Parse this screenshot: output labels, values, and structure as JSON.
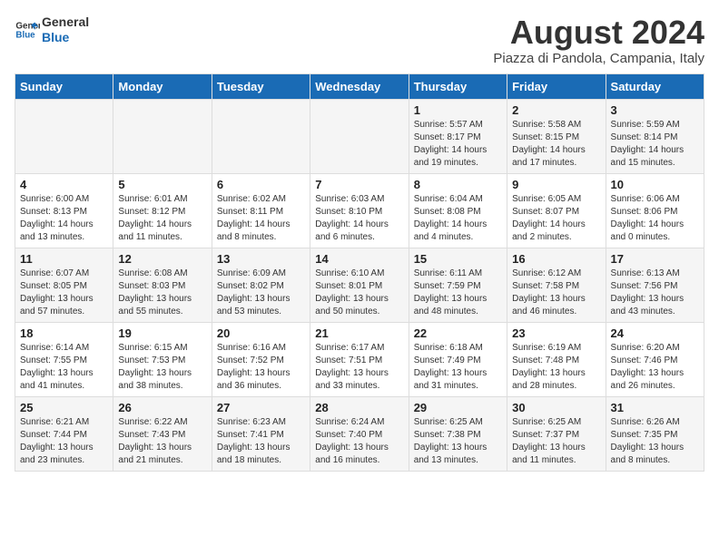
{
  "header": {
    "logo_line1": "General",
    "logo_line2": "Blue",
    "month_year": "August 2024",
    "location": "Piazza di Pandola, Campania, Italy"
  },
  "weekdays": [
    "Sunday",
    "Monday",
    "Tuesday",
    "Wednesday",
    "Thursday",
    "Friday",
    "Saturday"
  ],
  "weeks": [
    [
      {
        "day": "",
        "info": ""
      },
      {
        "day": "",
        "info": ""
      },
      {
        "day": "",
        "info": ""
      },
      {
        "day": "",
        "info": ""
      },
      {
        "day": "1",
        "info": "Sunrise: 5:57 AM\nSunset: 8:17 PM\nDaylight: 14 hours\nand 19 minutes."
      },
      {
        "day": "2",
        "info": "Sunrise: 5:58 AM\nSunset: 8:15 PM\nDaylight: 14 hours\nand 17 minutes."
      },
      {
        "day": "3",
        "info": "Sunrise: 5:59 AM\nSunset: 8:14 PM\nDaylight: 14 hours\nand 15 minutes."
      }
    ],
    [
      {
        "day": "4",
        "info": "Sunrise: 6:00 AM\nSunset: 8:13 PM\nDaylight: 14 hours\nand 13 minutes."
      },
      {
        "day": "5",
        "info": "Sunrise: 6:01 AM\nSunset: 8:12 PM\nDaylight: 14 hours\nand 11 minutes."
      },
      {
        "day": "6",
        "info": "Sunrise: 6:02 AM\nSunset: 8:11 PM\nDaylight: 14 hours\nand 8 minutes."
      },
      {
        "day": "7",
        "info": "Sunrise: 6:03 AM\nSunset: 8:10 PM\nDaylight: 14 hours\nand 6 minutes."
      },
      {
        "day": "8",
        "info": "Sunrise: 6:04 AM\nSunset: 8:08 PM\nDaylight: 14 hours\nand 4 minutes."
      },
      {
        "day": "9",
        "info": "Sunrise: 6:05 AM\nSunset: 8:07 PM\nDaylight: 14 hours\nand 2 minutes."
      },
      {
        "day": "10",
        "info": "Sunrise: 6:06 AM\nSunset: 8:06 PM\nDaylight: 14 hours\nand 0 minutes."
      }
    ],
    [
      {
        "day": "11",
        "info": "Sunrise: 6:07 AM\nSunset: 8:05 PM\nDaylight: 13 hours\nand 57 minutes."
      },
      {
        "day": "12",
        "info": "Sunrise: 6:08 AM\nSunset: 8:03 PM\nDaylight: 13 hours\nand 55 minutes."
      },
      {
        "day": "13",
        "info": "Sunrise: 6:09 AM\nSunset: 8:02 PM\nDaylight: 13 hours\nand 53 minutes."
      },
      {
        "day": "14",
        "info": "Sunrise: 6:10 AM\nSunset: 8:01 PM\nDaylight: 13 hours\nand 50 minutes."
      },
      {
        "day": "15",
        "info": "Sunrise: 6:11 AM\nSunset: 7:59 PM\nDaylight: 13 hours\nand 48 minutes."
      },
      {
        "day": "16",
        "info": "Sunrise: 6:12 AM\nSunset: 7:58 PM\nDaylight: 13 hours\nand 46 minutes."
      },
      {
        "day": "17",
        "info": "Sunrise: 6:13 AM\nSunset: 7:56 PM\nDaylight: 13 hours\nand 43 minutes."
      }
    ],
    [
      {
        "day": "18",
        "info": "Sunrise: 6:14 AM\nSunset: 7:55 PM\nDaylight: 13 hours\nand 41 minutes."
      },
      {
        "day": "19",
        "info": "Sunrise: 6:15 AM\nSunset: 7:53 PM\nDaylight: 13 hours\nand 38 minutes."
      },
      {
        "day": "20",
        "info": "Sunrise: 6:16 AM\nSunset: 7:52 PM\nDaylight: 13 hours\nand 36 minutes."
      },
      {
        "day": "21",
        "info": "Sunrise: 6:17 AM\nSunset: 7:51 PM\nDaylight: 13 hours\nand 33 minutes."
      },
      {
        "day": "22",
        "info": "Sunrise: 6:18 AM\nSunset: 7:49 PM\nDaylight: 13 hours\nand 31 minutes."
      },
      {
        "day": "23",
        "info": "Sunrise: 6:19 AM\nSunset: 7:48 PM\nDaylight: 13 hours\nand 28 minutes."
      },
      {
        "day": "24",
        "info": "Sunrise: 6:20 AM\nSunset: 7:46 PM\nDaylight: 13 hours\nand 26 minutes."
      }
    ],
    [
      {
        "day": "25",
        "info": "Sunrise: 6:21 AM\nSunset: 7:44 PM\nDaylight: 13 hours\nand 23 minutes."
      },
      {
        "day": "26",
        "info": "Sunrise: 6:22 AM\nSunset: 7:43 PM\nDaylight: 13 hours\nand 21 minutes."
      },
      {
        "day": "27",
        "info": "Sunrise: 6:23 AM\nSunset: 7:41 PM\nDaylight: 13 hours\nand 18 minutes."
      },
      {
        "day": "28",
        "info": "Sunrise: 6:24 AM\nSunset: 7:40 PM\nDaylight: 13 hours\nand 16 minutes."
      },
      {
        "day": "29",
        "info": "Sunrise: 6:25 AM\nSunset: 7:38 PM\nDaylight: 13 hours\nand 13 minutes."
      },
      {
        "day": "30",
        "info": "Sunrise: 6:25 AM\nSunset: 7:37 PM\nDaylight: 13 hours\nand 11 minutes."
      },
      {
        "day": "31",
        "info": "Sunrise: 6:26 AM\nSunset: 7:35 PM\nDaylight: 13 hours\nand 8 minutes."
      }
    ]
  ]
}
